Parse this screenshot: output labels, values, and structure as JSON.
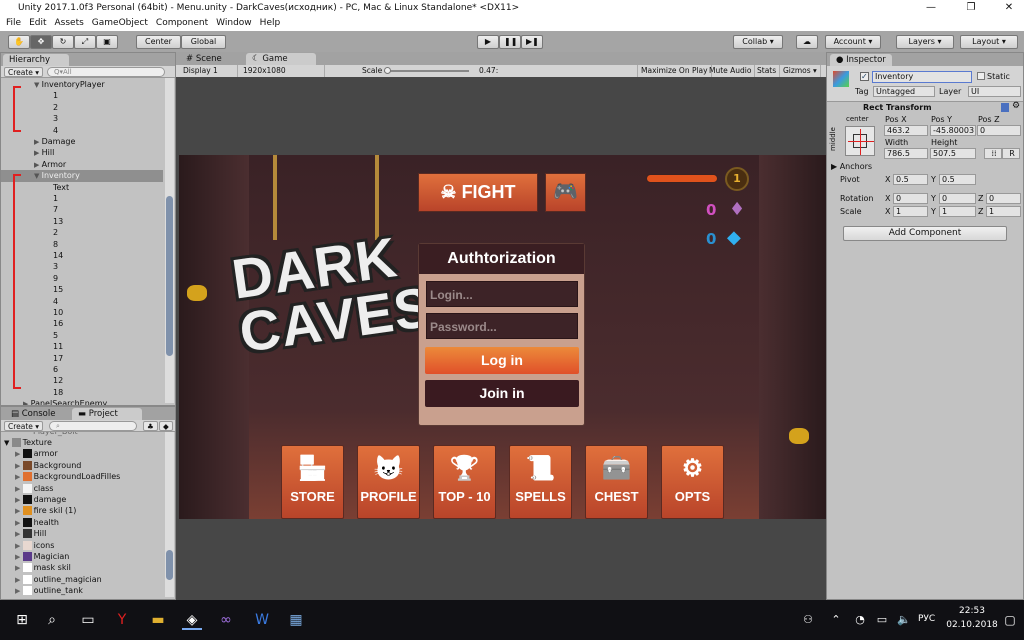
{
  "window": {
    "title": "Unity 2017.1.0f3 Personal (64bit) - Menu.unity - DarkCaves(исходник) - PC, Mac & Linux Standalone* <DX11>",
    "controls": [
      "—",
      "❐",
      "✕"
    ]
  },
  "menu": [
    "File",
    "Edit",
    "Assets",
    "GameObject",
    "Component",
    "Window",
    "Help"
  ],
  "toolbar": {
    "tools": [
      "hand-icon",
      "move-icon",
      "rotate-icon",
      "scale-icon",
      "rect-icon"
    ],
    "pivot": "Center",
    "space": "Global",
    "play": "▶",
    "pause": "❚❚",
    "step": "▶❚",
    "collab": "Collab ▾",
    "account": "Account ▾",
    "layers": "Layers ▾",
    "layout": "Layout ▾"
  },
  "hierarchy": {
    "tab": "Hierarchy",
    "create": "Create ▾",
    "search": "Q▾All",
    "rows": [
      {
        "label": "InventoryPlayer",
        "indent": 3,
        "arrow": "▼"
      },
      {
        "label": "1",
        "indent": 4
      },
      {
        "label": "2",
        "indent": 4
      },
      {
        "label": "3",
        "indent": 4
      },
      {
        "label": "4",
        "indent": 4
      },
      {
        "label": "Damage",
        "indent": 3,
        "arrow": "▶"
      },
      {
        "label": "Hill",
        "indent": 3,
        "arrow": "▶"
      },
      {
        "label": "Armor",
        "indent": 3,
        "arrow": "▶"
      },
      {
        "label": "Inventory",
        "indent": 3,
        "arrow": "▼",
        "selected": true
      },
      {
        "label": "Text",
        "indent": 4
      },
      {
        "label": "1",
        "indent": 4
      },
      {
        "label": "7",
        "indent": 4
      },
      {
        "label": "13",
        "indent": 4
      },
      {
        "label": "2",
        "indent": 4
      },
      {
        "label": "8",
        "indent": 4
      },
      {
        "label": "14",
        "indent": 4
      },
      {
        "label": "3",
        "indent": 4
      },
      {
        "label": "9",
        "indent": 4
      },
      {
        "label": "15",
        "indent": 4
      },
      {
        "label": "4",
        "indent": 4
      },
      {
        "label": "10",
        "indent": 4
      },
      {
        "label": "16",
        "indent": 4
      },
      {
        "label": "5",
        "indent": 4
      },
      {
        "label": "11",
        "indent": 4
      },
      {
        "label": "17",
        "indent": 4
      },
      {
        "label": "6",
        "indent": 4
      },
      {
        "label": "12",
        "indent": 4
      },
      {
        "label": "18",
        "indent": 4
      },
      {
        "label": "PanelSearchEnemy",
        "indent": 2,
        "arrow": "▶"
      }
    ]
  },
  "project": {
    "tabs": [
      "Console",
      "Project"
    ],
    "create": "Create ▾",
    "folder": "Texture",
    "partial": "Player_Bolt",
    "items": [
      {
        "label": "armor",
        "color": "#111"
      },
      {
        "label": "Background",
        "color": "#7a4a2a"
      },
      {
        "label": "BackgroundLoadFilles",
        "color": "#e07030"
      },
      {
        "label": "class",
        "color": "#f4f4f4"
      },
      {
        "label": "damage",
        "color": "#111"
      },
      {
        "label": "fire skil (1)",
        "color": "#e09020"
      },
      {
        "label": "health",
        "color": "#111"
      },
      {
        "label": "Hill",
        "color": "#333"
      },
      {
        "label": "icons",
        "color": "#e8d8d0"
      },
      {
        "label": "Magician",
        "color": "#5a3a8a"
      },
      {
        "label": "mask skil",
        "color": "#fff"
      },
      {
        "label": "outline_magician",
        "color": "#fff"
      },
      {
        "label": "outline_tank",
        "color": "#fff"
      }
    ]
  },
  "game_view": {
    "tabs": [
      "Scene",
      "Game"
    ],
    "display": "Display 1",
    "resolution": "1920x1080",
    "scale_label": "Scale",
    "scale_value": "0.47:",
    "maximize": "Maximize On Play",
    "mute": "Mute Audio",
    "stats": "Stats",
    "gizmos": "Gizmos ▾"
  },
  "game": {
    "logo": "DARK CAVES",
    "fight": "FIGHT",
    "level": "1",
    "crystals": "0",
    "gems": "0",
    "auth_title": "Authtorization",
    "login_placeholder": "Login...",
    "password_placeholder": "Password...",
    "login_button": "Log in",
    "join_button": "Join in",
    "menu_buttons": [
      "STORE",
      "PROFILE",
      "TOP - 10",
      "SPELLS",
      "CHEST",
      "OPTS"
    ],
    "accent": "#d9572f"
  },
  "inspector": {
    "tab": "Inspector",
    "name": "Inventory",
    "static": "Static",
    "tag_label": "Tag",
    "tag": "Untagged",
    "layer_label": "Layer",
    "layer": "UI",
    "component": "Rect Transform",
    "anchor_h": "center",
    "anchor_v": "middle",
    "pos_x_label": "Pos X",
    "pos_y_label": "Pos Y",
    "pos_z_label": "Pos Z",
    "pos_x": "463.2",
    "pos_y": "-45.80003",
    "pos_z": "0",
    "width_label": "Width",
    "height_label": "Height",
    "width": "786.5",
    "height": "507.5",
    "r": "R",
    "anchors": "Anchors",
    "pivot_label": "Pivot",
    "pivot_x": "0.5",
    "pivot_y": "0.5",
    "rotation_label": "Rotation",
    "rot_x": "0",
    "rot_y": "0",
    "rot_z": "0",
    "scale_label": "Scale",
    "scale_x": "1",
    "scale_y": "1",
    "scale_z": "1",
    "x": "X",
    "y": "Y",
    "z": "Z",
    "add_component": "Add Component"
  },
  "taskbar": {
    "lang": "РУС",
    "time": "22:53",
    "date": "02.10.2018"
  }
}
